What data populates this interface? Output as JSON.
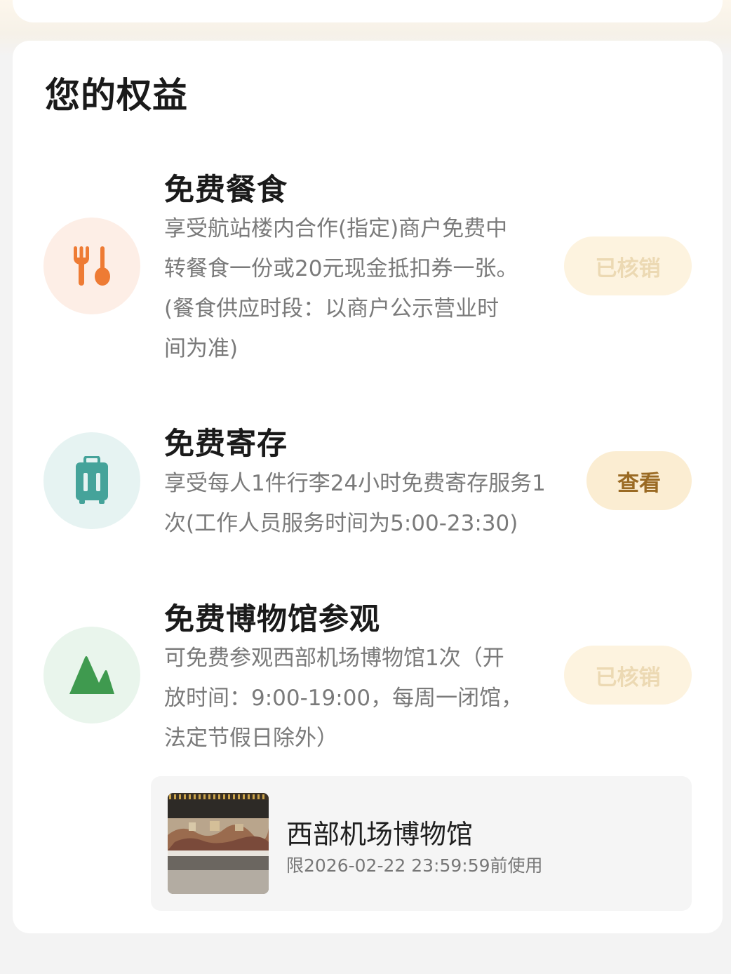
{
  "section_title": "您的权益",
  "benefits": [
    {
      "title": "免费餐食",
      "desc_lines": [
        "享受航站楼内合作(指定)商户免费中",
        "转餐食一份或20元现金抵扣券一张。",
        "(餐食供应时段：以商户公示营业时",
        "间为准)"
      ],
      "button": "已核销",
      "icon": "fork-spoon-icon",
      "icon_bg": "#fdeee6",
      "icon_color": "#ee7b34"
    },
    {
      "title": "免费寄存",
      "desc_lines": [
        "享受每人1件行李24小时免费寄存服务1",
        "次(工作人员服务时间为5:00-23:30)"
      ],
      "button": "查看",
      "icon": "luggage-icon",
      "icon_bg": "#e6f3f2",
      "icon_color": "#45a39a"
    },
    {
      "title": "免费博物馆参观",
      "desc_lines": [
        "可免费参观西部机场博物馆1次（开",
        "放时间：9:00-19:00，每周一闭馆，",
        "法定节假日除外）"
      ],
      "button": "已核销",
      "icon": "mountain-icon",
      "icon_bg": "#e9f5ec",
      "icon_color": "#3f9a4f"
    }
  ],
  "museum_card": {
    "name": "西部机场博物馆",
    "valid_until": "限2026-02-22 23:59:59前使用"
  }
}
